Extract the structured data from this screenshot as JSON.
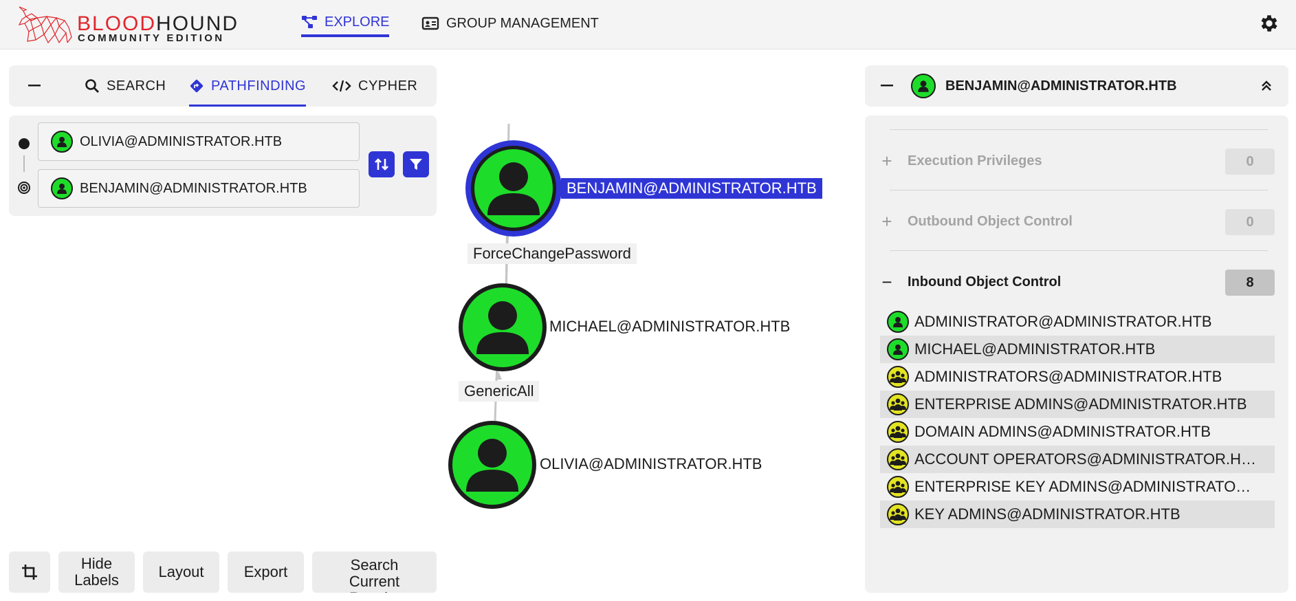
{
  "header": {
    "logo_word_red": "BLOOD",
    "logo_word_black": "HOUND",
    "logo_sub": "COMMUNITY EDITION",
    "nav": [
      {
        "label": "EXPLORE",
        "icon": "graph-nodes-icon",
        "active": true
      },
      {
        "label": "GROUP MANAGEMENT",
        "icon": "id-card-icon",
        "active": false
      }
    ],
    "settings_icon": "gear-icon"
  },
  "left_panel": {
    "tabs": [
      {
        "label": "SEARCH",
        "icon": "search-icon"
      },
      {
        "label": "PATHFINDING",
        "icon": "route-diamond-icon",
        "active": true
      },
      {
        "label": "CYPHER",
        "icon": "code-icon"
      }
    ],
    "pathfinding": {
      "start_value": "OLIVIA@ADMINISTRATOR.HTB",
      "end_value": "BENJAMIN@ADMINISTRATOR.HTB"
    }
  },
  "graph": {
    "nodes": [
      {
        "label": "BENJAMIN@ADMINISTRATOR.HTB",
        "selected": true
      },
      {
        "label": "MICHAEL@ADMINISTRATOR.HTB"
      },
      {
        "label": "OLIVIA@ADMINISTRATOR.HTB"
      }
    ],
    "edges": [
      {
        "label": "ForceChangePassword"
      },
      {
        "label": "GenericAll"
      }
    ]
  },
  "bottom_controls": {
    "hide_labels": "Hide Labels",
    "layout": "Layout",
    "export": "Export",
    "search_results": "Search Current Results"
  },
  "right_panel": {
    "title": "BENJAMIN@ADMINISTRATOR.HTB",
    "sections": [
      {
        "label": "Execution Privileges",
        "count": "0",
        "sign": "+"
      },
      {
        "label": "Outbound Object Control",
        "count": "0",
        "sign": "+"
      },
      {
        "label": "Inbound Object Control",
        "count": "8",
        "sign": "−"
      }
    ],
    "inbound": [
      {
        "name": "ADMINISTRATOR@ADMINISTRATOR.HTB",
        "type": "user"
      },
      {
        "name": "MICHAEL@ADMINISTRATOR.HTB",
        "type": "user"
      },
      {
        "name": "ADMINISTRATORS@ADMINISTRATOR.HTB",
        "type": "group"
      },
      {
        "name": "ENTERPRISE ADMINS@ADMINISTRATOR.HTB",
        "type": "group"
      },
      {
        "name": "DOMAIN ADMINS@ADMINISTRATOR.HTB",
        "type": "group"
      },
      {
        "name": "ACCOUNT OPERATORS@ADMINISTRATOR.H…",
        "type": "group"
      },
      {
        "name": "ENTERPRISE KEY ADMINS@ADMINISTRATO…",
        "type": "group"
      },
      {
        "name": "KEY ADMINS@ADMINISTRATOR.HTB",
        "type": "group"
      }
    ]
  },
  "colors": {
    "accent": "#2f35d5",
    "user_node": "#1ddd2a",
    "group_node": "#e3e422",
    "brand_red": "#e0262c"
  }
}
